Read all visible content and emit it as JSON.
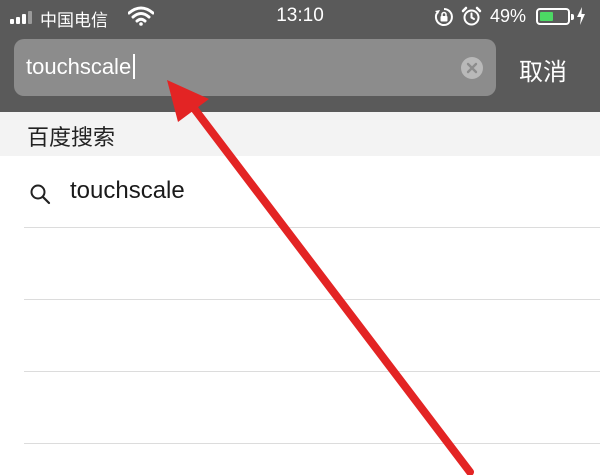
{
  "status_bar": {
    "carrier": "中国电信",
    "time": "13:10",
    "battery_percent": "49%",
    "battery_level": 0.49,
    "icons": [
      "signal-icon",
      "wifi-icon",
      "rotation-lock-icon",
      "alarm-icon",
      "battery-icon",
      "charging-bolt-icon"
    ]
  },
  "search": {
    "value": "touchscale",
    "clear_icon": "clear-icon",
    "cancel_label": "取消"
  },
  "section": {
    "title": "百度搜索"
  },
  "suggestions": [
    {
      "icon": "search-icon",
      "label": "touchscale"
    }
  ],
  "annotation": {
    "icon": "red-arrow-icon",
    "color": "#e32424"
  },
  "colors": {
    "header_bg": "#5a5a5a",
    "field_bg": "#8c8c8c",
    "section_bg": "#f3f3f3",
    "battery_green": "#4cd964"
  }
}
